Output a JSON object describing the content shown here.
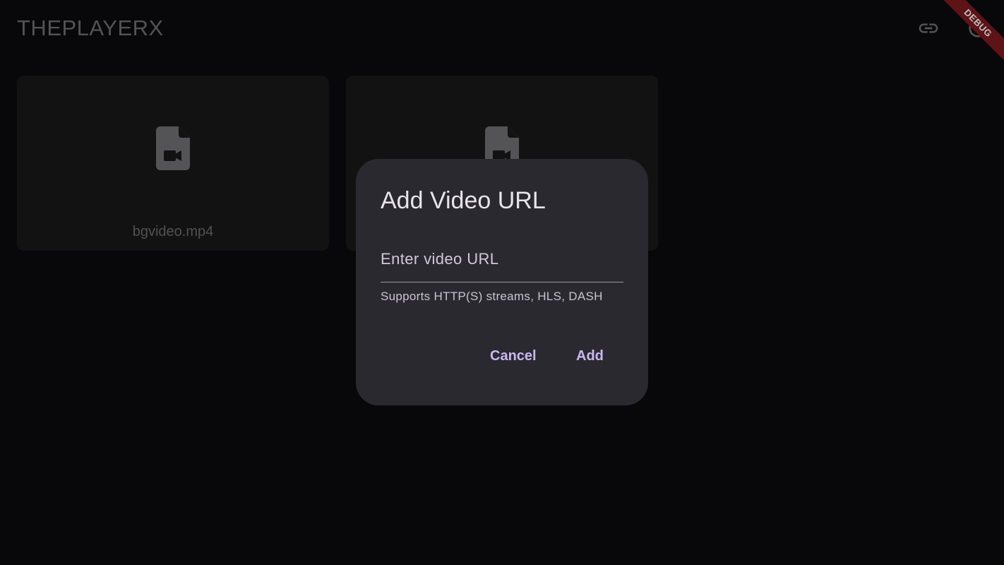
{
  "app": {
    "title": "THEPLAYERX",
    "debug_label": "DEBUG"
  },
  "header": {
    "actions": [
      {
        "icon": "link-icon"
      },
      {
        "icon": "settings-icon"
      }
    ]
  },
  "videos": [
    {
      "label": "bgvideo.mp4",
      "icon": "video-file-icon"
    },
    {
      "label": "",
      "icon": "video-file-icon"
    }
  ],
  "dialog": {
    "title": "Add Video URL",
    "input_placeholder": "Enter video URL",
    "input_value": "",
    "helper_text": "Supports HTTP(S) streams, HLS, DASH",
    "cancel_label": "Cancel",
    "add_label": "Add"
  },
  "colors": {
    "background": "#0b0b0e",
    "card": "#181819",
    "dialog": "#2a2930",
    "accent": "#cbb7f2",
    "debug_ribbon": "#7e1a1f"
  }
}
